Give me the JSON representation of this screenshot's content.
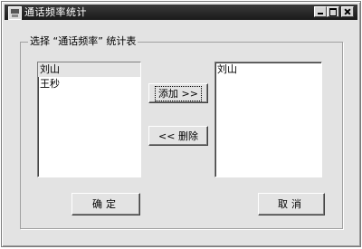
{
  "window": {
    "title": "通话频率统计"
  },
  "group": {
    "label": "选择 “通话频率” 统计表"
  },
  "left_list": {
    "items": [
      "刘山",
      "王秒"
    ]
  },
  "right_list": {
    "items": [
      "刘山"
    ]
  },
  "buttons": {
    "add": "添加 >>",
    "remove": "<< 删除",
    "ok": "确定",
    "cancel": "取消"
  }
}
